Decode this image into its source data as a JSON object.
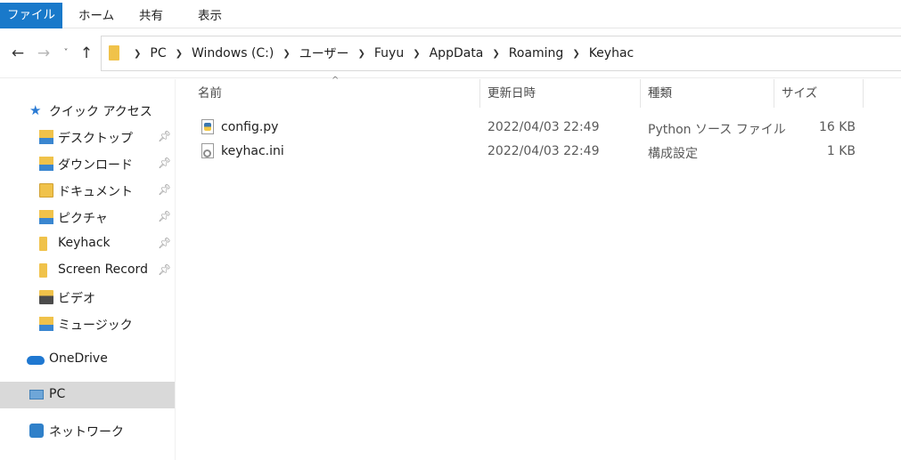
{
  "ribbon": {
    "tabs": [
      "ファイル",
      "ホーム",
      "共有",
      "表示"
    ]
  },
  "nav": {
    "back_icon": "arrow-left-icon",
    "forward_icon": "arrow-right-icon",
    "recent_icon": "chevron-down-icon",
    "up_icon": "arrow-up-icon"
  },
  "address": {
    "crumbs": [
      "PC",
      "Windows (C:)",
      "ユーザー",
      "Fuyu",
      "AppData",
      "Roaming",
      "Keyhac"
    ]
  },
  "sidebar": {
    "quick_access": "クイック アクセス",
    "items": [
      {
        "label": "デスクトップ",
        "pinned": true,
        "icon": "desktop-folder-icon"
      },
      {
        "label": "ダウンロード",
        "pinned": true,
        "icon": "downloads-folder-icon"
      },
      {
        "label": "ドキュメント",
        "pinned": true,
        "icon": "documents-folder-icon"
      },
      {
        "label": "ピクチャ",
        "pinned": true,
        "icon": "pictures-folder-icon"
      },
      {
        "label": "Keyhack",
        "pinned": true,
        "icon": "folder-icon"
      },
      {
        "label": "Screen Record",
        "pinned": true,
        "icon": "folder-icon"
      },
      {
        "label": "ビデオ",
        "pinned": false,
        "icon": "videos-folder-icon"
      },
      {
        "label": "ミュージック",
        "pinned": false,
        "icon": "music-folder-icon"
      }
    ],
    "onedrive": "OneDrive",
    "pc": "PC",
    "network": "ネットワーク"
  },
  "columns": {
    "name": "名前",
    "modified": "更新日時",
    "type": "種類",
    "size": "サイズ"
  },
  "files": [
    {
      "name": "config.py",
      "modified": "2022/04/03 22:49",
      "type": "Python ソース ファイル",
      "size": "16 KB",
      "icon": "python-file-icon"
    },
    {
      "name": "keyhac.ini",
      "modified": "2022/04/03 22:49",
      "type": "構成設定",
      "size": "1 KB",
      "icon": "settings-file-icon"
    }
  ],
  "colors": {
    "file_tab": "#1979ca",
    "selected_row": "#d9d9d9",
    "folder": "#f0c24a"
  }
}
